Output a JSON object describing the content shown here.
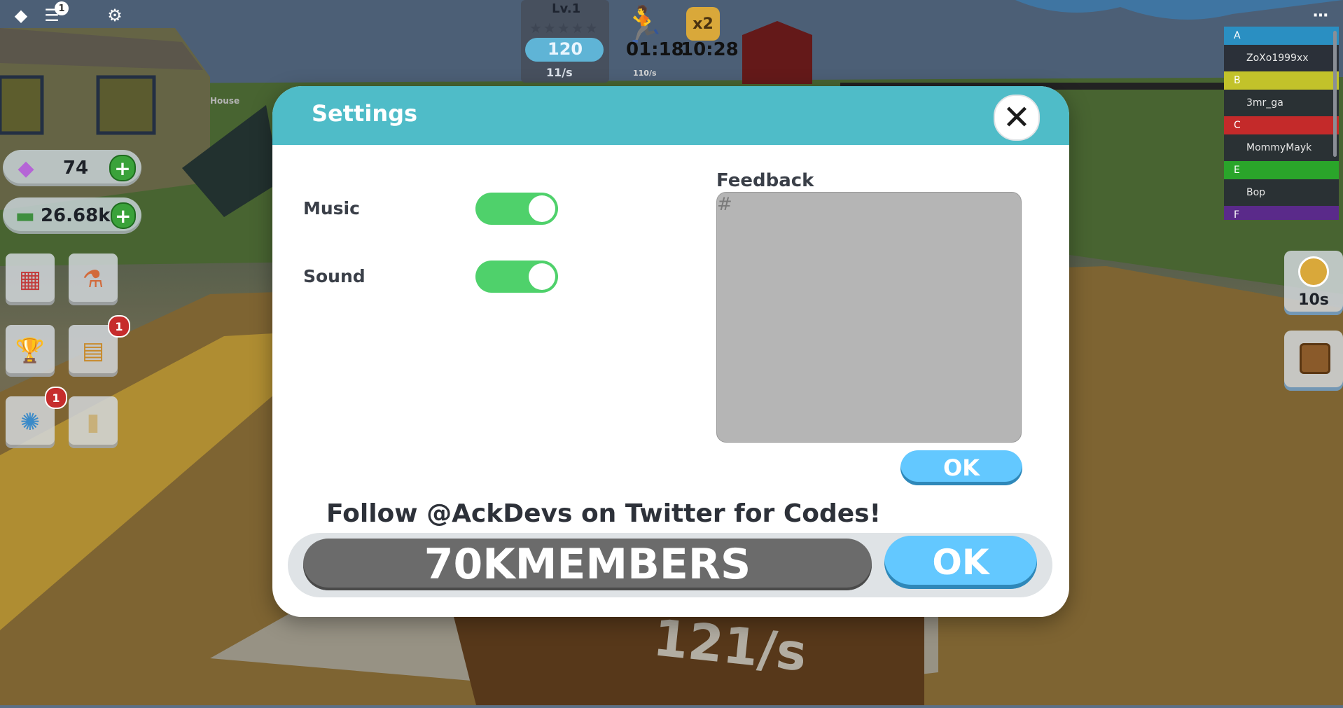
{
  "top_bar": {
    "chat_badge": "1"
  },
  "currency": {
    "gems": "74",
    "cash": "26.68k"
  },
  "side_badges": {
    "book": "1",
    "wheel": "1"
  },
  "hud": {
    "level_label": "Lv.1",
    "level_value": "120",
    "rate": "11/s",
    "speed_timer": "01:18",
    "boost_timer": "10:28",
    "boost_label": "x2",
    "sub_rate": "110/s"
  },
  "leaderboard": {
    "teams": [
      {
        "letter": "A",
        "color": "#2a8fc2",
        "player": "ZoXo1999xx"
      },
      {
        "letter": "B",
        "color": "#c2c22a",
        "player": "3mr_ga"
      },
      {
        "letter": "C",
        "color": "#c42a2a",
        "player": "MommyMayk"
      },
      {
        "letter": "E",
        "color": "#2aa52a",
        "player": "Bop"
      },
      {
        "letter": "F",
        "color": "#5a2a8a",
        "player": ""
      }
    ]
  },
  "right_panel": {
    "timer": "10s"
  },
  "world_text": {
    "house_sign": "House",
    "pad_rate": "121/s"
  },
  "settings": {
    "title": "Settings",
    "music_label": "Music",
    "sound_label": "Sound",
    "music_on": true,
    "sound_on": true,
    "feedback_label": "Feedback",
    "feedback_placeholder": "#",
    "feedback_ok": "OK",
    "follow_text": "Follow @AckDevs on Twitter for Codes!",
    "code_value": "70KMEMBERS",
    "code_ok": "OK"
  },
  "colors": {
    "header": "#4fbcc8",
    "toggle_on": "#4fd16b",
    "ok_button": "#63c8ff"
  }
}
